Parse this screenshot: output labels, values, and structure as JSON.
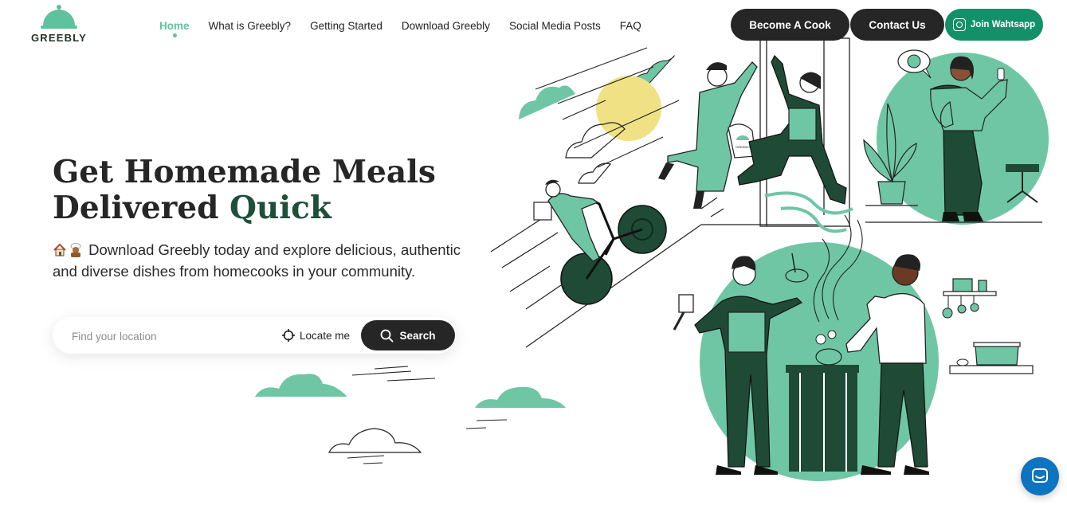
{
  "brand": {
    "name": "GREEBLY",
    "accent": "#5fc29e",
    "dark": "#1f4f3a",
    "whatsapp_green": "#149069"
  },
  "nav": {
    "items": [
      {
        "label": "Home",
        "active": true
      },
      {
        "label": "What is Greebly?"
      },
      {
        "label": "Getting Started"
      },
      {
        "label": "Download Greebly"
      },
      {
        "label": "Social Media Posts"
      },
      {
        "label": "FAQ"
      }
    ]
  },
  "header": {
    "become_cook": "Become A Cook",
    "contact": "Contact Us",
    "whatsapp": "Join Wahtsapp",
    "whatsapp_icon": "whatsapp-icon"
  },
  "hero": {
    "title_line1": "Get Homemade Meals",
    "title_line2": "Delivered",
    "title_accent": "Quick",
    "subtitle": "Download Greebly today and explore delicious, authentic and diverse dishes from homecooks in your community.",
    "emojis": [
      "house-emoji",
      "cook-emoji"
    ]
  },
  "search": {
    "placeholder": "Find your location",
    "value": "",
    "locate_label": "Locate me",
    "locate_icon": "crosshair-icon",
    "search_label": "Search",
    "search_icon": "search-icon"
  },
  "illustration": {
    "bag_label": "GREEBLY"
  },
  "chat": {
    "icon": "chat-icon"
  }
}
